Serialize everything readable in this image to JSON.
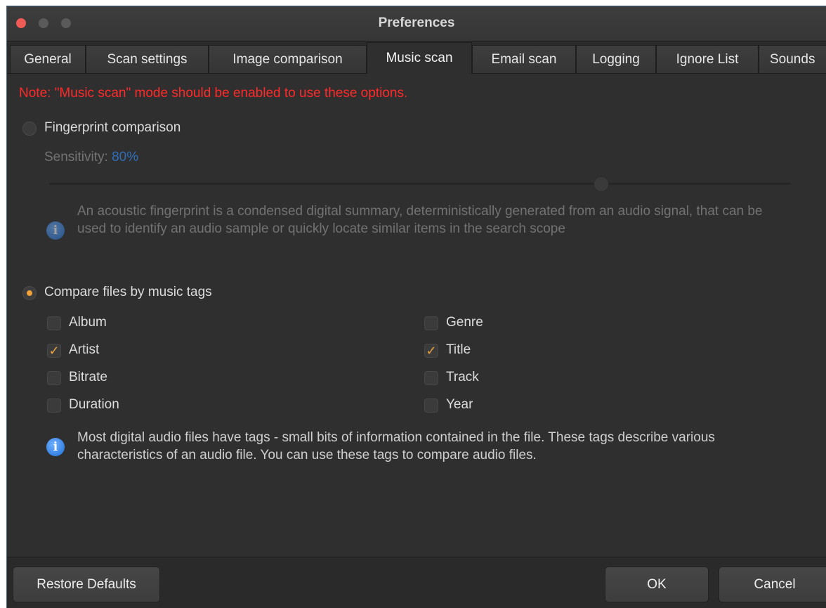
{
  "window": {
    "title": "Preferences"
  },
  "tabs": [
    {
      "label": "General"
    },
    {
      "label": "Scan settings"
    },
    {
      "label": "Image comparison"
    },
    {
      "label": "Music scan",
      "active": true
    },
    {
      "label": "Email scan"
    },
    {
      "label": "Logging"
    },
    {
      "label": "Ignore List"
    },
    {
      "label": "Sounds"
    }
  ],
  "music_scan": {
    "note": "Note: \"Music scan\" mode should be enabled to use these options.",
    "fingerprint": {
      "label": "Fingerprint comparison",
      "selected": false,
      "sensitivity_label": "Sensitivity:",
      "sensitivity_value": "80%",
      "slider_fraction": 0.8,
      "info": "An acoustic fingerprint is a condensed digital summary, deterministically generated from an audio signal, that can be used to identify an audio sample or quickly locate similar items in the search scope"
    },
    "tags": {
      "label": "Compare files by music tags",
      "selected": true,
      "left": [
        {
          "label": "Album",
          "checked": false
        },
        {
          "label": "Artist",
          "checked": true
        },
        {
          "label": "Bitrate",
          "checked": false
        },
        {
          "label": "Duration",
          "checked": false
        }
      ],
      "right": [
        {
          "label": "Genre",
          "checked": false
        },
        {
          "label": "Title",
          "checked": true
        },
        {
          "label": "Track",
          "checked": false
        },
        {
          "label": "Year",
          "checked": false
        }
      ],
      "info": "Most digital audio files have tags - small bits of information contained in the file. These tags describe various characteristics of an audio file. You can use these tags to compare audio files."
    }
  },
  "footer": {
    "restore_label": "Restore Defaults",
    "ok_label": "OK",
    "cancel_label": "Cancel"
  },
  "colors": {
    "note": "#ff2a2a",
    "accent": "#f0a23a",
    "sensitivity_value": "#2f6fba",
    "info_icon": "#1f6fd6"
  },
  "icons": {
    "check": "checkmark-icon",
    "info": "info-icon",
    "close": "close-traffic-light-icon"
  }
}
